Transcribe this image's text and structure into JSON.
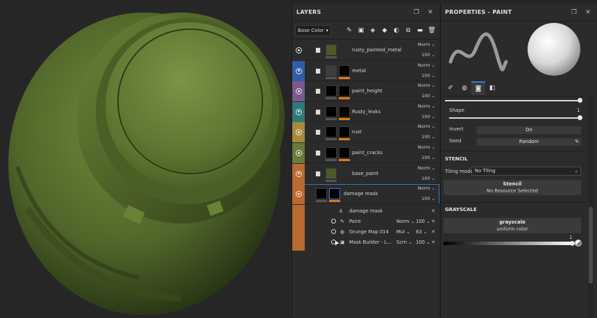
{
  "layers_panel": {
    "title": "LAYERS",
    "channel_select": "Base Color",
    "layers": [
      {
        "name": "rusty_painted_metal",
        "blend": "Norm",
        "opacity": "100",
        "strip": "#2b2b2b",
        "thumb": "#4a5a28",
        "mask": null,
        "bar": "#555555"
      },
      {
        "name": "metal",
        "blend": "Norm",
        "opacity": "100",
        "strip": "#2f5ea8",
        "thumb": "#3d3d3d",
        "mask": "#000000",
        "bar": "#e07a1a"
      },
      {
        "name": "paint_height",
        "blend": "Norm",
        "opacity": "100",
        "strip": "#7a5a8e",
        "thumb": "#000000",
        "mask": "#000000",
        "bar": "#e07a1a"
      },
      {
        "name": "Rusty_leaks",
        "blend": "Norm",
        "opacity": "100",
        "strip": "#2e7b76",
        "thumb": "#000000",
        "mask": "#000000",
        "bar": "#e07a1a"
      },
      {
        "name": "rust",
        "blend": "Norm",
        "opacity": "100",
        "strip": "#a88a3a",
        "thumb": "#000000",
        "mask": "#000000",
        "bar": "#e07a1a"
      },
      {
        "name": "paint_cracks",
        "blend": "Norm",
        "opacity": "100",
        "strip": "#6a7a3a",
        "thumb": "#000000",
        "mask": "#000000",
        "bar": "#e07a1a"
      },
      {
        "name": "base_paint",
        "blend": "Norm",
        "opacity": "100",
        "strip": "#b86a30",
        "thumb": "#4a5a28",
        "mask": null,
        "bar": "#555555"
      },
      {
        "name": "damage mask",
        "blend": "Norm",
        "opacity": "100",
        "strip": "#b86a30",
        "thumb": "#000000",
        "mask": "#000000",
        "bar": "#e07a1a"
      }
    ],
    "effects": [
      {
        "name": "damage mask",
        "blend": "",
        "opacity": ""
      },
      {
        "name": "Paint",
        "blend": "Norm",
        "opacity": "100"
      },
      {
        "name": "Grunge Map 014",
        "blend": "Mul",
        "opacity": "63"
      },
      {
        "name": "Mask Builder - L...",
        "blend": "Scrn",
        "opacity": "100"
      }
    ]
  },
  "properties_panel": {
    "title": "PROPERTIES - PAINT",
    "shape_label": "Shape",
    "shape_value": "1",
    "invert_label": "Invert",
    "invert_value": "On",
    "seed_label": "Seed",
    "seed_value": "Random",
    "stencil_section": "STENCIL",
    "tiling_label": "Tiling mode",
    "tiling_value": "No Tiling",
    "stencil_title": "Stencil",
    "stencil_sub": "No Resource Selected",
    "grayscale_section": "GRAYSCALE",
    "grayscale_title": "grayscale",
    "grayscale_sub": "uniform color",
    "grayscale_value": "1"
  }
}
